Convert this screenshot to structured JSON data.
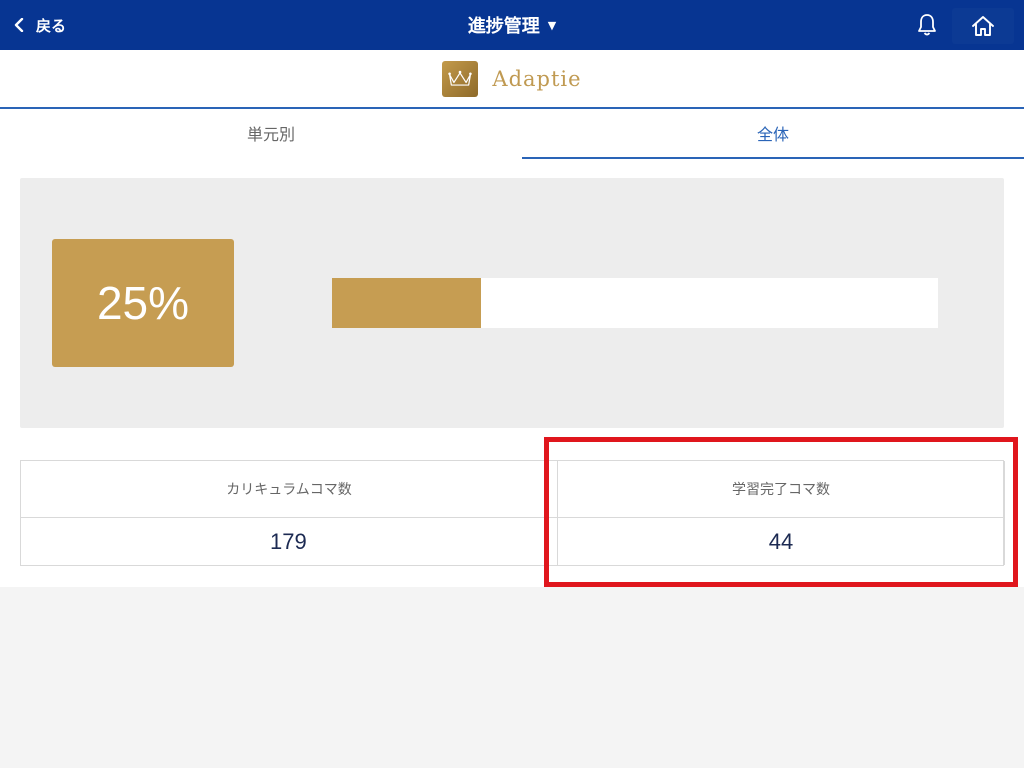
{
  "header": {
    "back_label": "戻る",
    "title": "進捗管理",
    "title_caret": "▼",
    "bell_icon": "bell-icon",
    "home_icon": "home-icon",
    "bg_color": "#073592"
  },
  "brand": {
    "name": "Adaptie",
    "logo_icon": "crown-icon"
  },
  "tabs": [
    {
      "label": "単元別",
      "active": false
    },
    {
      "label": "全体",
      "active": true
    }
  ],
  "progress": {
    "percent_label": "25%",
    "fraction": 0.246,
    "color": "#c69d52"
  },
  "stats": {
    "curriculum": {
      "label": "カリキュラムコマ数",
      "value": "179"
    },
    "completed": {
      "label": "学習完了コマ数",
      "value": "44"
    }
  },
  "annotation": {
    "highlight_color": "#e0161d"
  }
}
